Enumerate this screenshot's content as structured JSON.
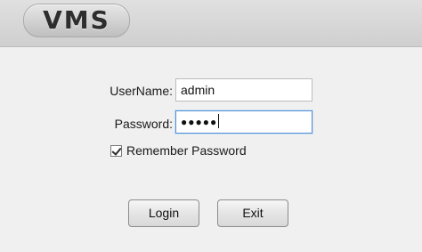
{
  "header": {
    "logo_text": "VMS"
  },
  "login_form": {
    "username_label": "UserName:",
    "username_value": "admin",
    "password_label": "Password:",
    "password_mask": "●●●●●",
    "remember_label": "Remember Password",
    "remember_checked": true
  },
  "buttons": {
    "login_label": "Login",
    "exit_label": "Exit"
  },
  "colors": {
    "background": "#f0f0f0",
    "header_gradient_top": "#e0e0e0",
    "focus_border": "#4f8fd6"
  }
}
